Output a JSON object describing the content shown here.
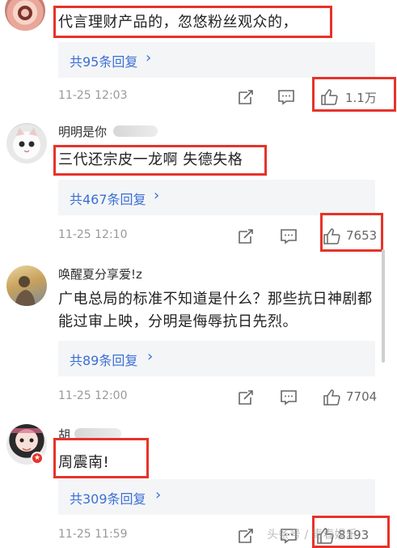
{
  "comments": [
    {
      "text": "代言理财产品的，忽悠粉丝观众的，",
      "replies_label": "共95条回复",
      "time": "11-25 12:03",
      "likes": "1.1万"
    },
    {
      "username": "明明是你",
      "text": "三代还宗皮一龙啊 失德失格",
      "replies_label": "共467条回复",
      "time": "11-25 12:10",
      "likes": "7653"
    },
    {
      "username": "唤醒夏分享爱!z",
      "text": "广电总局的标准不知道是什么？那些抗日神剧都能过审上映，分明是侮辱抗日先烈。",
      "replies_label": "共89条回复",
      "time": "11-25 12:00",
      "likes": "7704"
    },
    {
      "username": "胡",
      "text": "周震南!",
      "replies_label": "共309条回复",
      "time": "11-25 11:59",
      "likes": "8193"
    }
  ],
  "icons": {
    "repost": "repost-icon",
    "comment": "comment-icon",
    "like": "thumbs-up-icon",
    "chevron": "chevron-right-icon"
  },
  "watermark": "头条号 / 青春娱乐",
  "colors": {
    "highlight_box": "#e6332a",
    "link_blue": "#3b6fd4",
    "reply_bg": "#f4f5f7"
  }
}
